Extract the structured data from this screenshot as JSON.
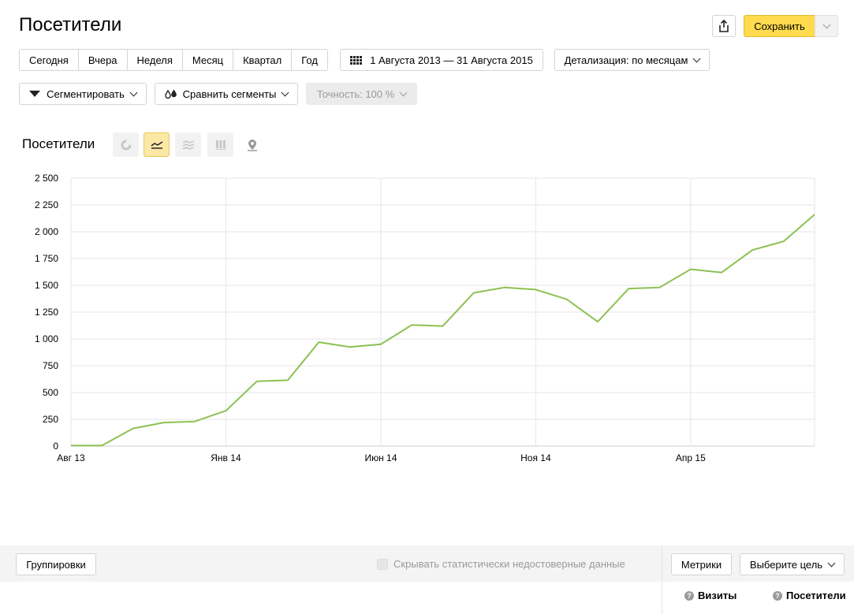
{
  "header": {
    "title": "Посетители",
    "save_label": "Сохранить"
  },
  "periods": [
    "Сегодня",
    "Вчера",
    "Неделя",
    "Месяц",
    "Квартал",
    "Год"
  ],
  "date_range": "1 Августа 2013 — 31 Августа 2015",
  "detail_label": "Детализация: по месяцам",
  "segment_label": "Сегментировать",
  "compare_label": "Сравнить сегменты",
  "accuracy_label": "Точность: 100 %",
  "chart_section": {
    "title": "Посетители",
    "views": [
      "pie-chart-icon",
      "line-chart-icon",
      "area-chart-icon",
      "bar-chart-icon",
      "map-pin-icon"
    ],
    "active_view": "line-chart-icon"
  },
  "footer": {
    "groupings_label": "Группировки",
    "hide_unreliable_label": "Скрывать статистически недостоверные данные",
    "metrics_label": "Метрики",
    "goal_label": "Выберите цель",
    "columns": [
      "Визиты",
      "Посетители"
    ]
  },
  "colors": {
    "line": "#8cc152",
    "save": "#ffdb4d",
    "active_view": "#fbe7a6"
  },
  "chart_data": {
    "type": "line",
    "title": "",
    "x": [
      "2013-08",
      "2013-09",
      "2013-10",
      "2013-11",
      "2013-12",
      "2014-01",
      "2014-02",
      "2014-03",
      "2014-04",
      "2014-05",
      "2014-06",
      "2014-07",
      "2014-08",
      "2014-09",
      "2014-10",
      "2014-11",
      "2014-12",
      "2015-01",
      "2015-02",
      "2015-03",
      "2015-04",
      "2015-05",
      "2015-06",
      "2015-07",
      "2015-08"
    ],
    "series": [
      {
        "values": [
          5,
          5,
          165,
          220,
          230,
          330,
          605,
          615,
          970,
          925,
          950,
          1130,
          1120,
          1430,
          1480,
          1460,
          1370,
          1160,
          1470,
          1480,
          1650,
          1620,
          1830,
          1910,
          2160
        ]
      }
    ],
    "x_tick_labels": [
      "Авг 13",
      "Янв 14",
      "Июн 14",
      "Ноя 14",
      "Апр 15"
    ],
    "x_tick_index": [
      0,
      5,
      10,
      15,
      20
    ],
    "y_tick_labels": [
      "0",
      "250",
      "500",
      "750",
      "1 000",
      "1 250",
      "1 500",
      "1 750",
      "2 000",
      "2 250",
      "2 500"
    ],
    "y_ticks": [
      0,
      250,
      500,
      750,
      1000,
      1250,
      1500,
      1750,
      2000,
      2250,
      2500
    ],
    "ylim": [
      0,
      2500
    ],
    "grid": true,
    "legend": "none",
    "xlabel": "",
    "ylabel": ""
  }
}
